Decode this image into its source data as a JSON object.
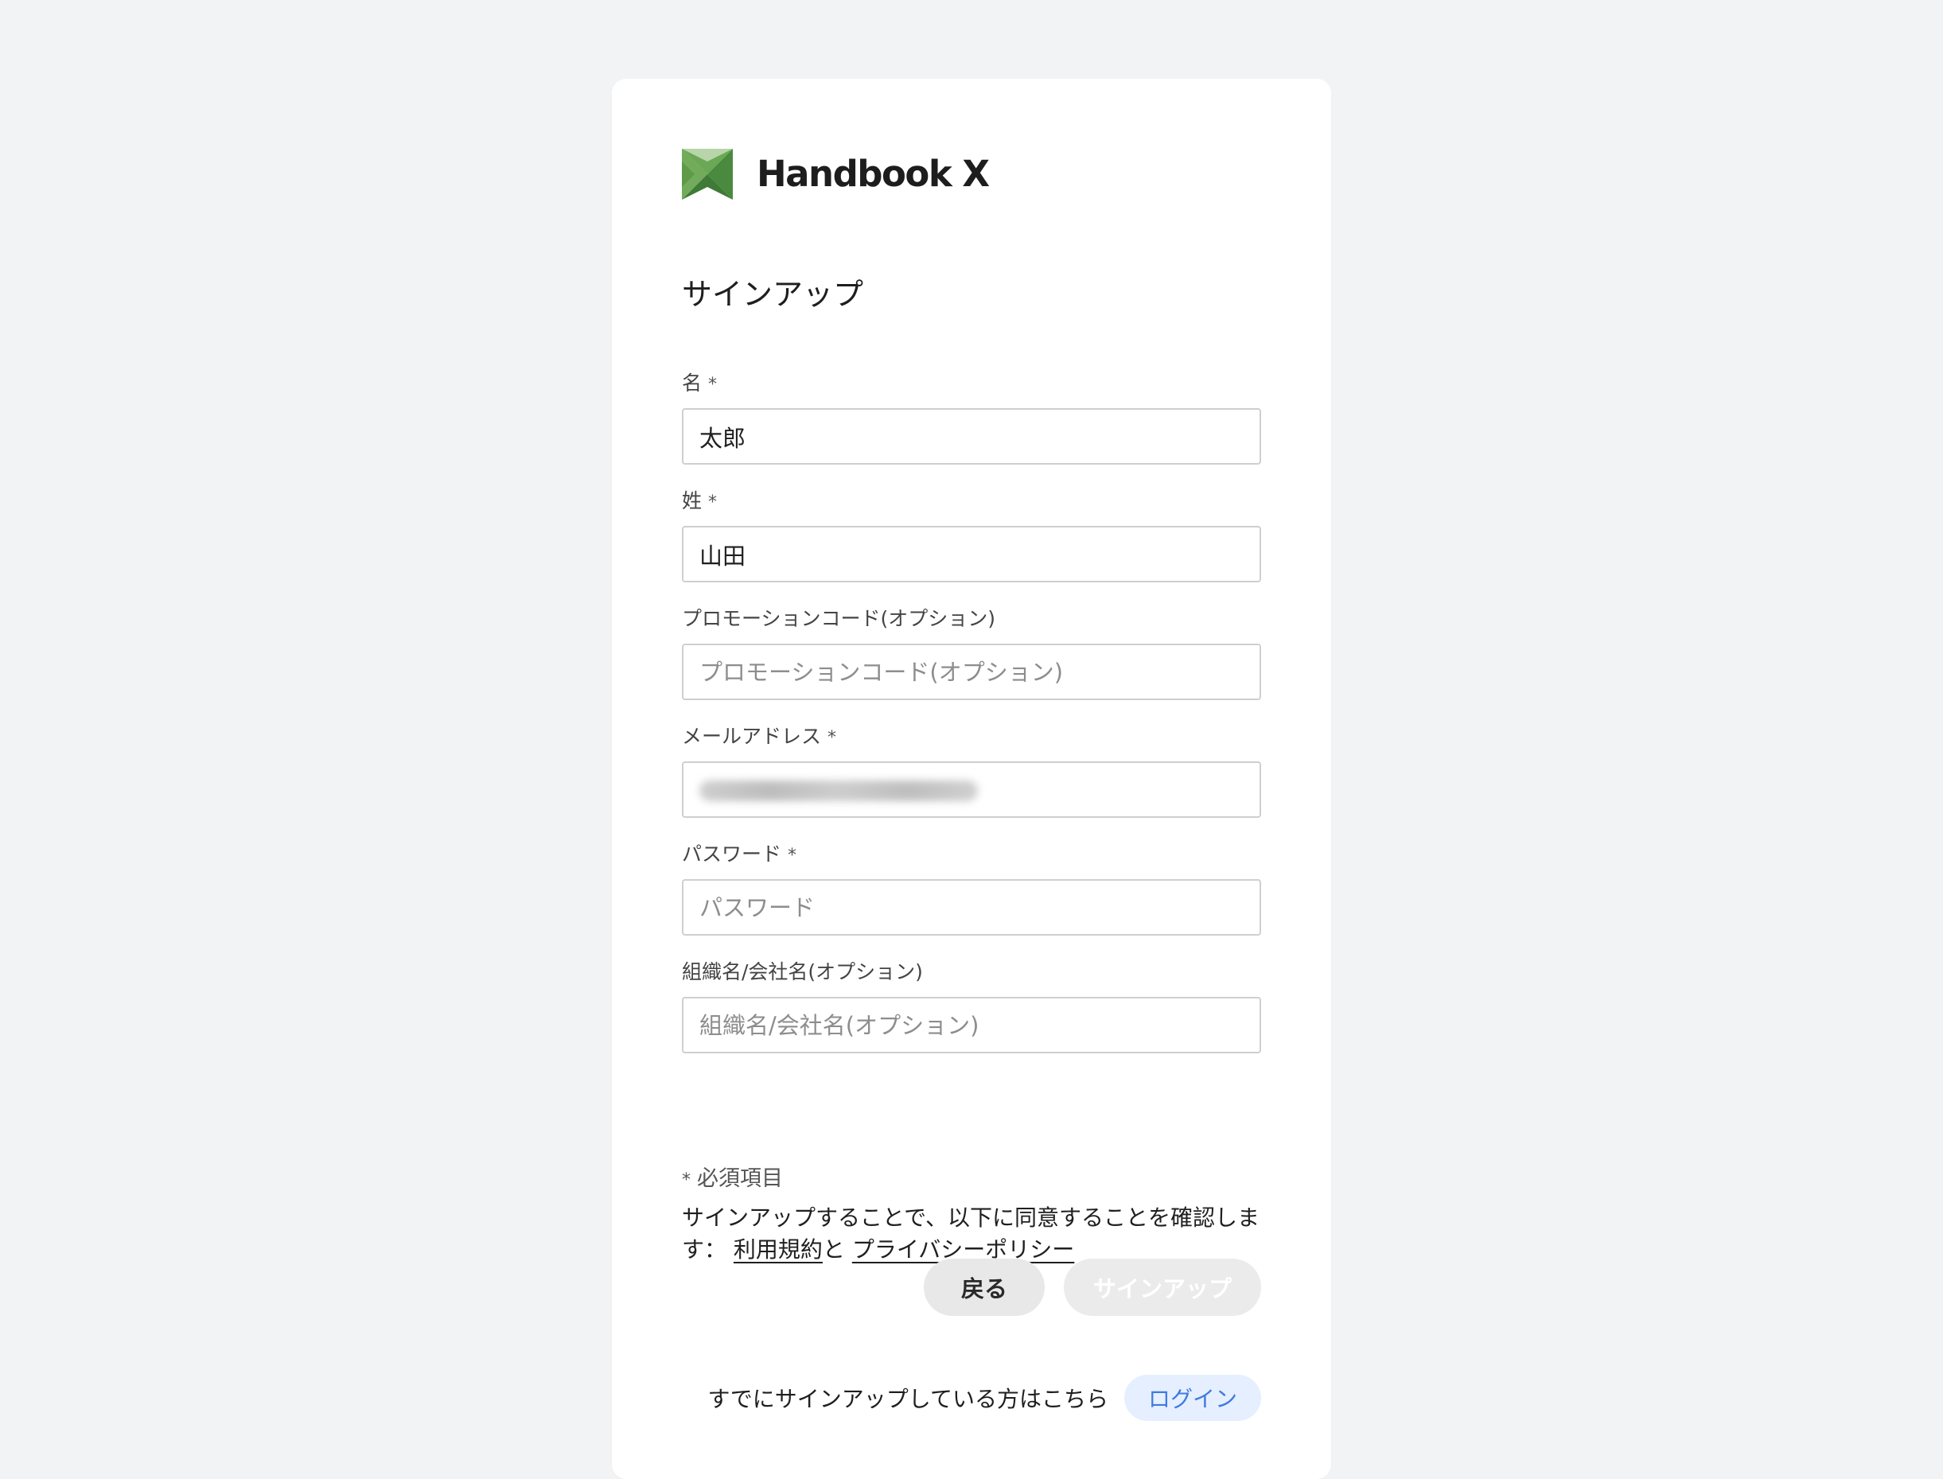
{
  "brand": {
    "name": "Handbook X",
    "logo_icon": "handbook-x-logo",
    "colors": {
      "light": "#7cb261",
      "mid": "#5e9a48",
      "dark": "#3f7a37"
    }
  },
  "form": {
    "title": "サインアップ",
    "fields": {
      "first_name": {
        "label": "名",
        "required_mark": "*",
        "value": "太郎",
        "placeholder": ""
      },
      "last_name": {
        "label": "姓",
        "required_mark": "*",
        "value": "山田",
        "placeholder": ""
      },
      "promo_code": {
        "label": "プロモーションコード(オプション)",
        "value": "",
        "placeholder": "プロモーションコード(オプション)"
      },
      "email": {
        "label": "メールアドレス",
        "required_mark": "*",
        "value": "",
        "placeholder": ""
      },
      "password": {
        "label": "パスワード",
        "required_mark": "*",
        "value": "",
        "placeholder": "パスワード"
      },
      "organization": {
        "label": "組織名/会社名(オプション)",
        "value": "",
        "placeholder": "組織名/会社名(オプション)"
      }
    },
    "required_note": {
      "mark": "*",
      "text": "必須項目"
    },
    "agreement": {
      "prefix": "サインアップすることで、以下に同意することを確認します：",
      "terms_link": "利用規約",
      "joiner": "と",
      "privacy_link": "プライバシーポリシー"
    },
    "buttons": {
      "back": "戻る",
      "signup": "サインアップ"
    },
    "login": {
      "prompt": "すでにサインアップしている方はこちら",
      "button": "ログイン"
    }
  }
}
